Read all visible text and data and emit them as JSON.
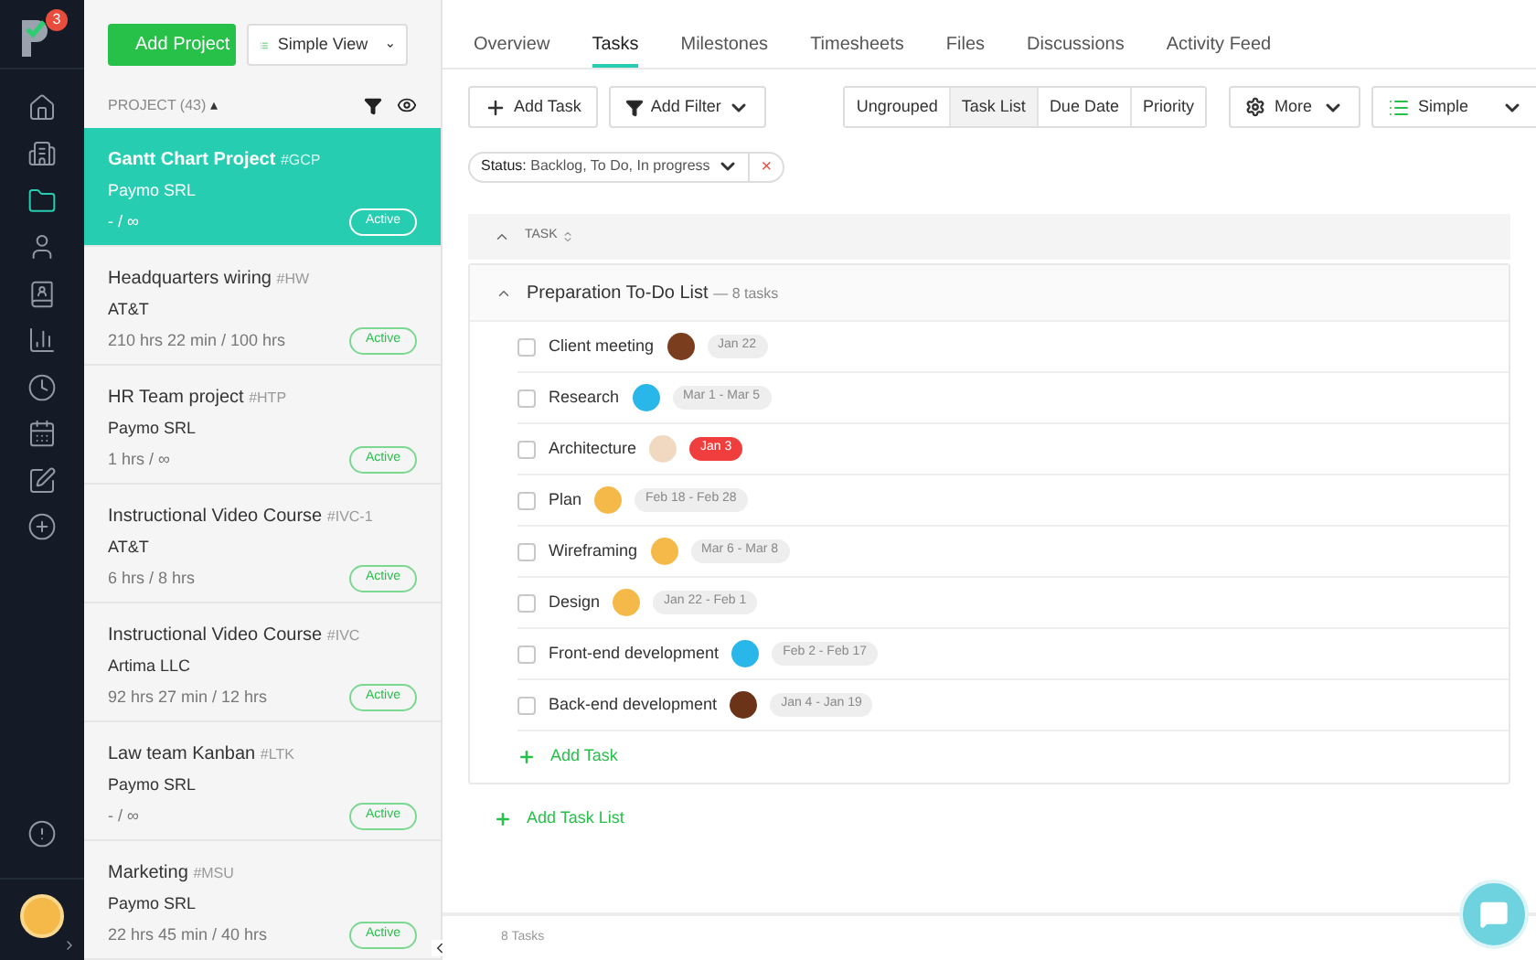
{
  "logo": {
    "badge": "3"
  },
  "nav_items": [
    {
      "kind": "home",
      "selected": false
    },
    {
      "kind": "clients",
      "selected": false
    },
    {
      "kind": "projects",
      "selected": true
    },
    {
      "kind": "users",
      "selected": false
    },
    {
      "kind": "invoices",
      "selected": false
    },
    {
      "kind": "reports",
      "selected": false
    },
    {
      "kind": "time",
      "selected": false
    },
    {
      "kind": "calendar",
      "selected": false
    },
    {
      "kind": "edit",
      "selected": false
    },
    {
      "kind": "add",
      "selected": false
    }
  ],
  "project_panel": {
    "add_button": "Add Project",
    "view_button": "Simple View",
    "header": "PROJECT (43)",
    "sort_indicator": "▴",
    "projects": [
      {
        "name": "Gantt Chart Project",
        "code": "#GCP",
        "client": "Paymo SRL",
        "hours": "- / ∞",
        "status": "Active",
        "selected": true
      },
      {
        "name": "Headquarters wiring",
        "code": "#HW",
        "client": "AT&T",
        "hours": "210 hrs 22 min / 100 hrs",
        "status": "Active",
        "selected": false
      },
      {
        "name": "HR Team project",
        "code": "#HTP",
        "client": "Paymo SRL",
        "hours": "1 hrs / ∞",
        "status": "Active",
        "selected": false
      },
      {
        "name": "Instructional Video Course",
        "code": "#IVC-1",
        "client": "AT&T",
        "hours": "6 hrs / 8 hrs",
        "status": "Active",
        "selected": false
      },
      {
        "name": "Instructional Video Course",
        "code": "#IVC",
        "client": "Artima LLC",
        "hours": "92 hrs 27 min / 12 hrs",
        "status": "Active",
        "selected": false
      },
      {
        "name": "Law team Kanban",
        "code": "#LTK",
        "client": "Paymo SRL",
        "hours": "- / ∞",
        "status": "Active",
        "selected": false
      },
      {
        "name": "Marketing",
        "code": "#MSU",
        "client": "Paymo SRL",
        "hours": "22 hrs 45 min / 40 hrs",
        "status": "Active",
        "selected": false
      }
    ]
  },
  "tabs": [
    {
      "label": "Overview",
      "selected": false
    },
    {
      "label": "Tasks",
      "selected": true
    },
    {
      "label": "Milestones",
      "selected": false
    },
    {
      "label": "Timesheets",
      "selected": false
    },
    {
      "label": "Files",
      "selected": false
    },
    {
      "label": "Discussions",
      "selected": false
    },
    {
      "label": "Activity Feed",
      "selected": false
    }
  ],
  "toolbar": {
    "add_task": "Add Task",
    "add_filter": "Add Filter",
    "grouping": [
      {
        "label": "Ungrouped",
        "selected": false
      },
      {
        "label": "Task List",
        "selected": true
      },
      {
        "label": "Due Date",
        "selected": false
      },
      {
        "label": "Priority",
        "selected": false
      }
    ],
    "more": "More",
    "view": "Simple"
  },
  "filter": {
    "label": "Status:",
    "value": "Backlog, To Do, In progress",
    "remove": "×"
  },
  "table_header": "TASK",
  "task_list": {
    "title": "Preparation To-Do List",
    "count": "— 8 tasks",
    "tasks": [
      {
        "name": "Client meeting",
        "color": "#7a3d1e",
        "date": "Jan 22",
        "overdue": false,
        "checked": false
      },
      {
        "name": "Research",
        "color": "#29b6e8",
        "date": "Mar 1 - Mar 5",
        "overdue": false,
        "checked": false
      },
      {
        "name": "Architecture",
        "color": "#f0d9c0",
        "date": "Jan 3",
        "overdue": true,
        "checked": false
      },
      {
        "name": "Plan",
        "color": "#f5b94a",
        "date": "Feb 18 - Feb 28",
        "overdue": false,
        "checked": false
      },
      {
        "name": "Wireframing",
        "color": "#f5b94a",
        "date": "Mar 6 - Mar 8",
        "overdue": false,
        "checked": false
      },
      {
        "name": "Design",
        "color": "#f5b94a",
        "date": "Jan 22 - Feb 1",
        "overdue": false,
        "checked": false
      },
      {
        "name": "Front-end development",
        "color": "#29b6e8",
        "date": "Feb 2 - Feb 17",
        "overdue": false,
        "checked": false
      },
      {
        "name": "Back-end development",
        "color": "#6b3318",
        "date": "Jan 4 - Jan 19",
        "overdue": false,
        "checked": false
      }
    ],
    "add_task": "Add Task"
  },
  "add_task_list": "Add Task List",
  "footer": "8 Tasks"
}
